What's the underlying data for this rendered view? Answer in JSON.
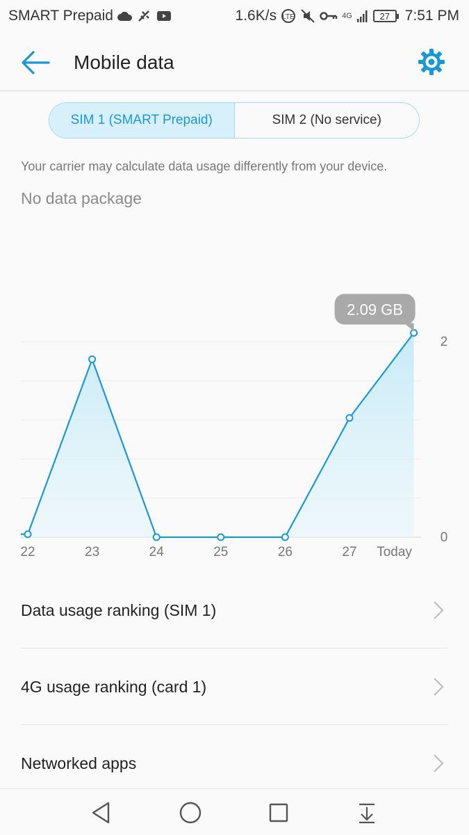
{
  "status_bar": {
    "carrier": "SMART Prepaid",
    "net_speed": "1.6K/s",
    "network_type": "4G",
    "battery": "27",
    "time": "7:51 PM",
    "icons": [
      "cloud-icon",
      "usb-debug-icon",
      "youtube-icon",
      "lte-icon",
      "mute-icon",
      "vpn-key-icon",
      "signal-icon"
    ]
  },
  "app_bar": {
    "title": "Mobile data",
    "back_icon": "back-arrow-icon",
    "settings_icon": "gear-icon",
    "accent_color": "#1a98d6"
  },
  "sim_tabs": [
    {
      "label": "SIM 1 (SMART Prepaid)",
      "selected": true
    },
    {
      "label": "SIM 2 (No service)",
      "selected": false
    }
  ],
  "carrier_note": "Your carrier may calculate data usage differently from your device.",
  "package_status": "No data package",
  "chart_data": {
    "type": "area",
    "categories": [
      "22",
      "23",
      "24",
      "25",
      "26",
      "27",
      "Today"
    ],
    "values": [
      0.03,
      1.82,
      0.0,
      0.0,
      0.0,
      1.22,
      2.09
    ],
    "ylim": [
      0,
      2
    ],
    "ytick_labels": [
      "0",
      "2"
    ],
    "grid": true,
    "highlight_label": "2.09 GB",
    "line_color": "#1a98d6"
  },
  "menu_items": [
    {
      "label": "Data usage ranking (SIM 1)"
    },
    {
      "label": "4G usage ranking (card 1)"
    },
    {
      "label": "Networked apps"
    }
  ],
  "nav_bar": [
    "back-triangle-icon",
    "home-circle-icon",
    "recents-square-icon",
    "notification-pull-icon"
  ]
}
